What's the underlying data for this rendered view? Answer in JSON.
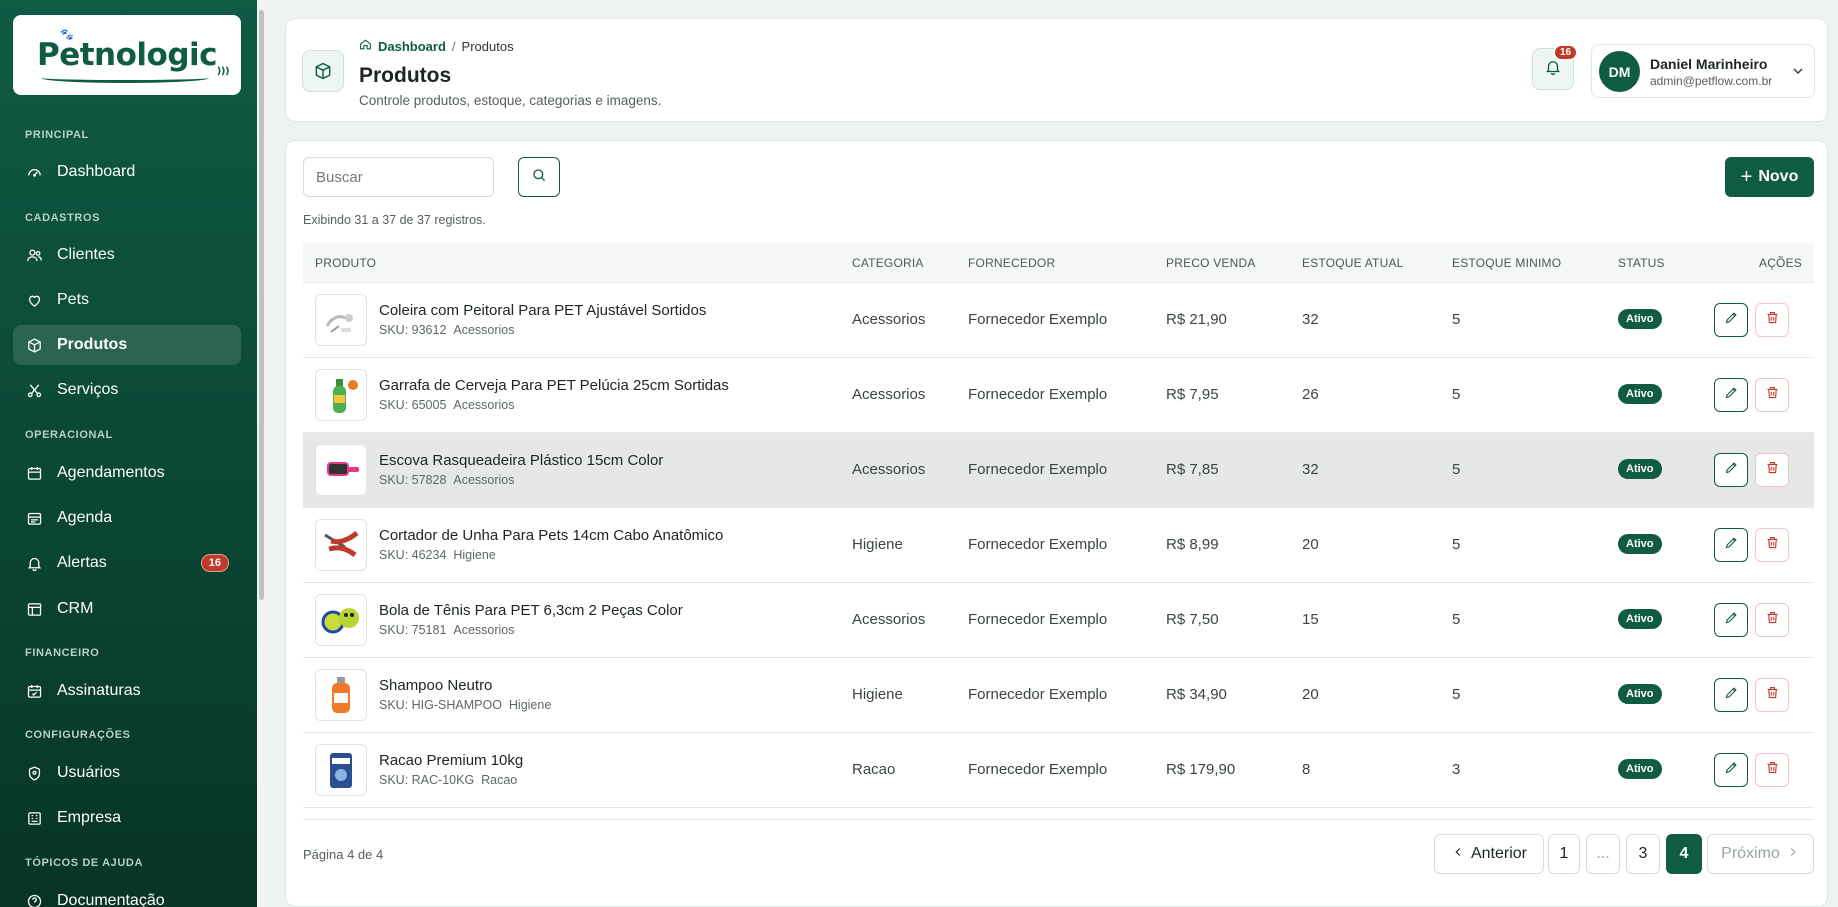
{
  "brand": {
    "name": "Petnologic"
  },
  "sidebar": {
    "sections": {
      "principal": "PRINCIPAL",
      "cadastros": "CADASTROS",
      "operacional": "OPERACIONAL",
      "financeiro": "FINANCEIRO",
      "configuracoes": "CONFIGURAÇÕES",
      "ajuda": "TÓPICOS DE AJUDA"
    },
    "items": [
      {
        "label": "Dashboard",
        "icon": "gauge-icon"
      },
      {
        "label": "Clientes",
        "icon": "users-icon"
      },
      {
        "label": "Pets",
        "icon": "heart-icon"
      },
      {
        "label": "Produtos",
        "icon": "box-icon",
        "active": true
      },
      {
        "label": "Serviços",
        "icon": "scissors-icon"
      },
      {
        "label": "Agendamentos",
        "icon": "calendar-icon"
      },
      {
        "label": "Agenda",
        "icon": "calendar-list-icon"
      },
      {
        "label": "Alertas",
        "icon": "bell-icon",
        "badge": "16"
      },
      {
        "label": "CRM",
        "icon": "crm-icon"
      },
      {
        "label": "Assinaturas",
        "icon": "calendar-check-icon"
      },
      {
        "label": "Usuários",
        "icon": "shield-icon"
      },
      {
        "label": "Empresa",
        "icon": "building-icon"
      },
      {
        "label": "Documentação",
        "icon": "help-icon"
      }
    ]
  },
  "header": {
    "breadcrumb": {
      "home": "Dashboard",
      "separator": "/",
      "current": "Produtos"
    },
    "title": "Produtos",
    "subtitle": "Controle produtos, estoque, categorias e imagens.",
    "notifications": "16",
    "user": {
      "initials": "DM",
      "name": "Daniel Marinheiro",
      "email": "admin@petflow.com.br"
    }
  },
  "toolbar": {
    "search_placeholder": "Buscar",
    "new_label": "Novo",
    "records_info": "Exibindo 31 a 37 de 37 registros."
  },
  "table": {
    "columns": [
      "PRODUTO",
      "CATEGORIA",
      "FORNECEDOR",
      "PRECO VENDA",
      "ESTOQUE ATUAL",
      "ESTOQUE MINIMO",
      "STATUS",
      "AÇÕES"
    ],
    "rows": [
      {
        "name": "Coleira com Peitoral Para PET Ajustável Sortidos",
        "sku": "SKU: 93612",
        "sku_cat": "Acessorios",
        "category": "Acessorios",
        "supplier": "Fornecedor Exemplo",
        "price": "R$ 21,90",
        "stock": "32",
        "min": "5",
        "status": "Ativo",
        "thumb": "harness"
      },
      {
        "name": "Garrafa de Cerveja Para PET Pelúcia 25cm Sortidas",
        "sku": "SKU: 65005",
        "sku_cat": "Acessorios",
        "category": "Acessorios",
        "supplier": "Fornecedor Exemplo",
        "price": "R$ 7,95",
        "stock": "26",
        "min": "5",
        "status": "Ativo",
        "thumb": "bottle"
      },
      {
        "name": "Escova Rasqueadeira Plástico 15cm Color",
        "sku": "SKU: 57828",
        "sku_cat": "Acessorios",
        "category": "Acessorios",
        "supplier": "Fornecedor Exemplo",
        "price": "R$ 7,85",
        "stock": "32",
        "min": "5",
        "status": "Ativo",
        "thumb": "brush"
      },
      {
        "name": "Cortador de Unha Para Pets 14cm Cabo Anatômico",
        "sku": "SKU: 46234",
        "sku_cat": "Higiene",
        "category": "Higiene",
        "supplier": "Fornecedor Exemplo",
        "price": "R$ 8,99",
        "stock": "20",
        "min": "5",
        "status": "Ativo",
        "thumb": "clipper"
      },
      {
        "name": "Bola de Tênis Para PET 6,3cm 2 Peças Color",
        "sku": "SKU: 75181",
        "sku_cat": "Acessorios",
        "category": "Acessorios",
        "supplier": "Fornecedor Exemplo",
        "price": "R$ 7,50",
        "stock": "15",
        "min": "5",
        "status": "Ativo",
        "thumb": "balls"
      },
      {
        "name": "Shampoo Neutro",
        "sku": "SKU: HIG-SHAMPOO",
        "sku_cat": "Higiene",
        "category": "Higiene",
        "supplier": "Fornecedor Exemplo",
        "price": "R$ 34,90",
        "stock": "20",
        "min": "5",
        "status": "Ativo",
        "thumb": "shampoo"
      },
      {
        "name": "Racao Premium 10kg",
        "sku": "SKU: RAC-10KG",
        "sku_cat": "Racao",
        "category": "Racao",
        "supplier": "Fornecedor Exemplo",
        "price": "R$ 179,90",
        "stock": "8",
        "min": "3",
        "status": "Ativo",
        "thumb": "food"
      }
    ]
  },
  "pagination": {
    "info": "Página 4 de 4",
    "prev": "Anterior",
    "next": "Próximo",
    "pages": [
      "1",
      "...",
      "3",
      "4"
    ],
    "current": "4"
  },
  "colors": {
    "brand": "#0f5b44",
    "danger": "#c0392b"
  }
}
